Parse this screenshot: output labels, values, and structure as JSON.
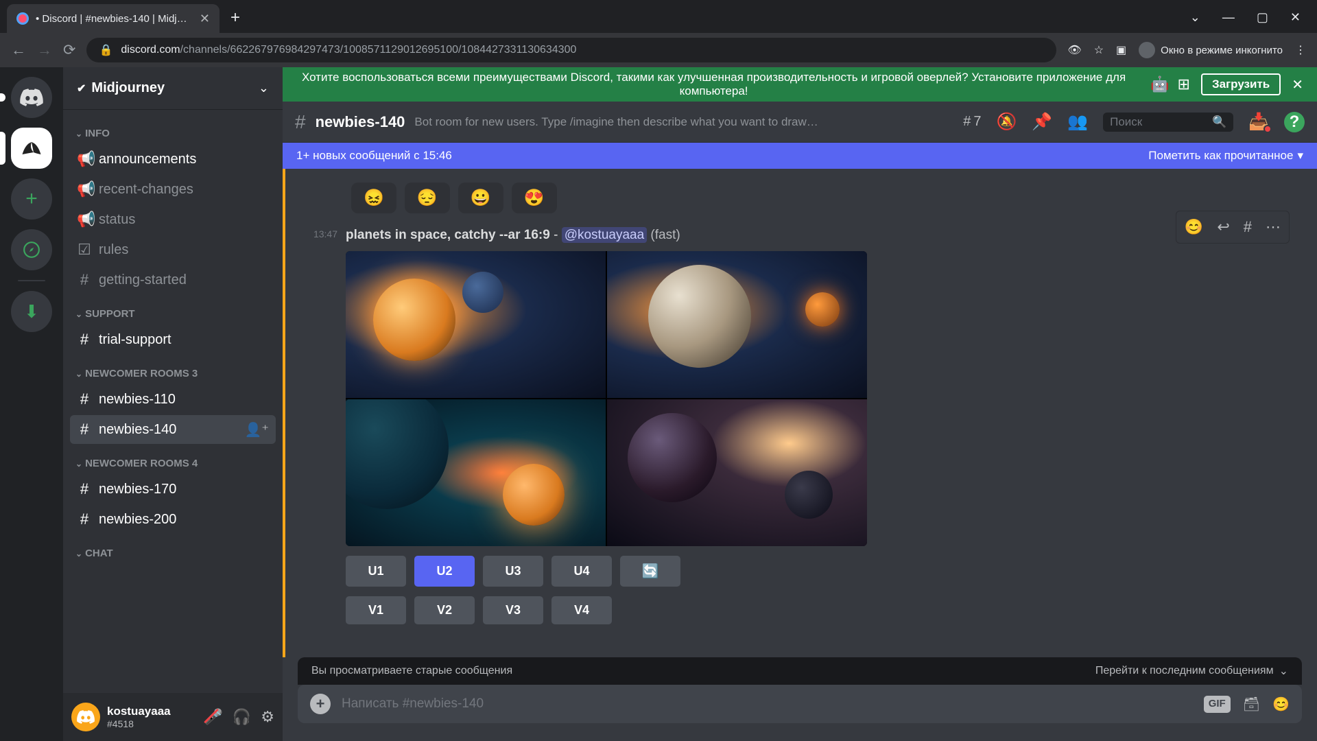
{
  "browser": {
    "tab_title": "• Discord | #newbies-140 | Midj…",
    "url_domain": "discord.com",
    "url_path": "/channels/662267976984297473/1008571129012695100/1084427331130634300",
    "incognito_label": "Окно в режиме инкогнито"
  },
  "promo": {
    "text": "Хотите воспользоваться всеми преимуществами Discord, такими как улучшенная производительность и игровой оверлей? Установите приложение для компьютера!",
    "download": "Загрузить"
  },
  "server": {
    "name": "Midjourney"
  },
  "categories": [
    {
      "label": "INFO",
      "channels": [
        {
          "name": "announcements",
          "icon": "📢",
          "bright": true
        },
        {
          "name": "recent-changes",
          "icon": "📢"
        },
        {
          "name": "status",
          "icon": "📢"
        },
        {
          "name": "rules",
          "icon": "☑"
        },
        {
          "name": "getting-started",
          "icon": "#"
        }
      ]
    },
    {
      "label": "SUPPORT",
      "channels": [
        {
          "name": "trial-support",
          "icon": "#",
          "bright": true
        }
      ]
    },
    {
      "label": "NEWCOMER ROOMS 3",
      "channels": [
        {
          "name": "newbies-110",
          "icon": "#",
          "bright": true
        },
        {
          "name": "newbies-140",
          "icon": "#",
          "active": true,
          "add": true
        }
      ]
    },
    {
      "label": "NEWCOMER ROOMS 4",
      "channels": [
        {
          "name": "newbies-170",
          "icon": "#",
          "bright": true
        },
        {
          "name": "newbies-200",
          "icon": "#",
          "bright": true
        }
      ]
    },
    {
      "label": "CHAT",
      "channels": []
    }
  ],
  "user": {
    "name": "kostuayaaa",
    "tag": "#4518"
  },
  "header": {
    "channel": "newbies-140",
    "topic": "Bot room for new users. Type /imagine then describe what you want to draw…",
    "threads": "7",
    "search_placeholder": "Поиск"
  },
  "new_messages": {
    "text": "1+ новых сообщений с 15:46",
    "mark_read": "Пометить как прочитанное"
  },
  "reactions": [
    "😖",
    "😔",
    "😀",
    "😍"
  ],
  "message": {
    "time": "13:47",
    "prompt": "planets in space, catchy --ar 16:9",
    "sep": " - ",
    "mention": "@kostuayaaa",
    "suffix": " (fast)"
  },
  "buttons": {
    "u": [
      "U1",
      "U2",
      "U3",
      "U4"
    ],
    "v": [
      "V1",
      "V2",
      "V3",
      "V4"
    ],
    "refresh": "🔄"
  },
  "jump": {
    "viewing_old": "Вы просматриваете старые сообщения",
    "jump_latest": "Перейти к последним сообщениям"
  },
  "input": {
    "placeholder": "Написать #newbies-140",
    "gif": "GIF"
  }
}
